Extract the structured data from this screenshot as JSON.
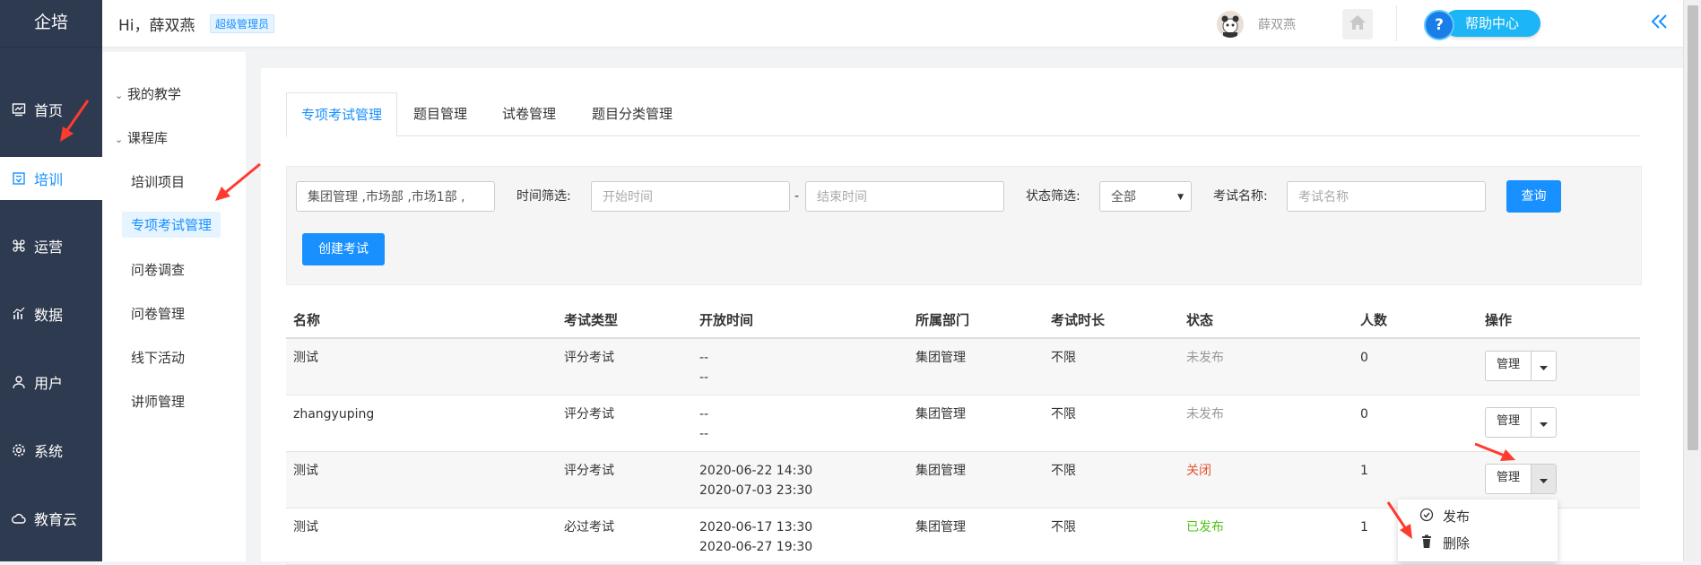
{
  "brand": "企培",
  "nav": [
    {
      "label": "首页",
      "icon": "chart-board-icon"
    },
    {
      "label": "培训",
      "icon": "book-icon",
      "active": true
    },
    {
      "label": "运营",
      "icon": "command-icon"
    },
    {
      "label": "数据",
      "icon": "bar-chart-icon"
    },
    {
      "label": "用户",
      "icon": "user-icon"
    },
    {
      "label": "系统",
      "icon": "gear-icon"
    },
    {
      "label": "教育云",
      "icon": "cloud-icon"
    }
  ],
  "header": {
    "greeting": "Hi，薛双燕",
    "role_badge": "超级管理员",
    "username": "薛双燕",
    "help_label": "帮助中心",
    "help_glyph": "?"
  },
  "subnav": {
    "groups": [
      {
        "label": "我的教学"
      },
      {
        "label": "课程库"
      }
    ],
    "items": [
      {
        "label": "培训项目"
      },
      {
        "label": "专项考试管理",
        "active": true
      },
      {
        "label": "问卷调查"
      },
      {
        "label": "问卷管理"
      },
      {
        "label": "线下活动"
      },
      {
        "label": "讲师管理"
      }
    ]
  },
  "tabs": [
    {
      "label": "专项考试管理",
      "active": true
    },
    {
      "label": "题目管理"
    },
    {
      "label": "试卷管理"
    },
    {
      "label": "题目分类管理"
    }
  ],
  "filters": {
    "department_value": "集团管理 ,市场部 ,市场1部 ,",
    "time_label": "时间筛选:",
    "start_placeholder": "开始时间",
    "range_sep": "-",
    "end_placeholder": "结束时间",
    "status_label": "状态筛选:",
    "status_value": "全部",
    "name_label": "考试名称:",
    "name_placeholder": "考试名称",
    "query_button": "查询",
    "create_button": "创建考试"
  },
  "table": {
    "columns": [
      "名称",
      "考试类型",
      "开放时间",
      "所属部门",
      "考试时长",
      "状态",
      "人数",
      "操作"
    ],
    "rows": [
      {
        "name": "测试",
        "type": "评分考试",
        "open_start": "--",
        "open_end": "--",
        "dept": "集团管理",
        "duration": "不限",
        "status": "未发布",
        "status_kind": "off",
        "count": "0",
        "action": "管理"
      },
      {
        "name": "zhangyuping",
        "type": "评分考试",
        "open_start": "--",
        "open_end": "--",
        "dept": "集团管理",
        "duration": "不限",
        "status": "未发布",
        "status_kind": "off",
        "count": "0",
        "action": "管理"
      },
      {
        "name": "测试",
        "type": "评分考试",
        "open_start": "2020-06-22 14:30",
        "open_end": "2020-07-03 23:30",
        "dept": "集团管理",
        "duration": "不限",
        "status": "关闭",
        "status_kind": "closed",
        "count": "1",
        "action": "管理"
      },
      {
        "name": "测试",
        "type": "必过考试",
        "open_start": "2020-06-17 13:30",
        "open_end": "2020-06-27 19:30",
        "dept": "集团管理",
        "duration": "不限",
        "status": "已发布",
        "status_kind": "pub",
        "count": "1",
        "action": "管理"
      }
    ]
  },
  "dropdown": {
    "items": [
      {
        "label": "发布",
        "icon": "check-circle-icon"
      },
      {
        "label": "删除",
        "icon": "trash-icon"
      }
    ]
  },
  "colors": {
    "sidebar": "#2e3a4f",
    "primary": "#1890ff",
    "status_closed": "#e4532f",
    "status_published": "#52c41a",
    "annotation_arrow": "#ff3b30"
  }
}
